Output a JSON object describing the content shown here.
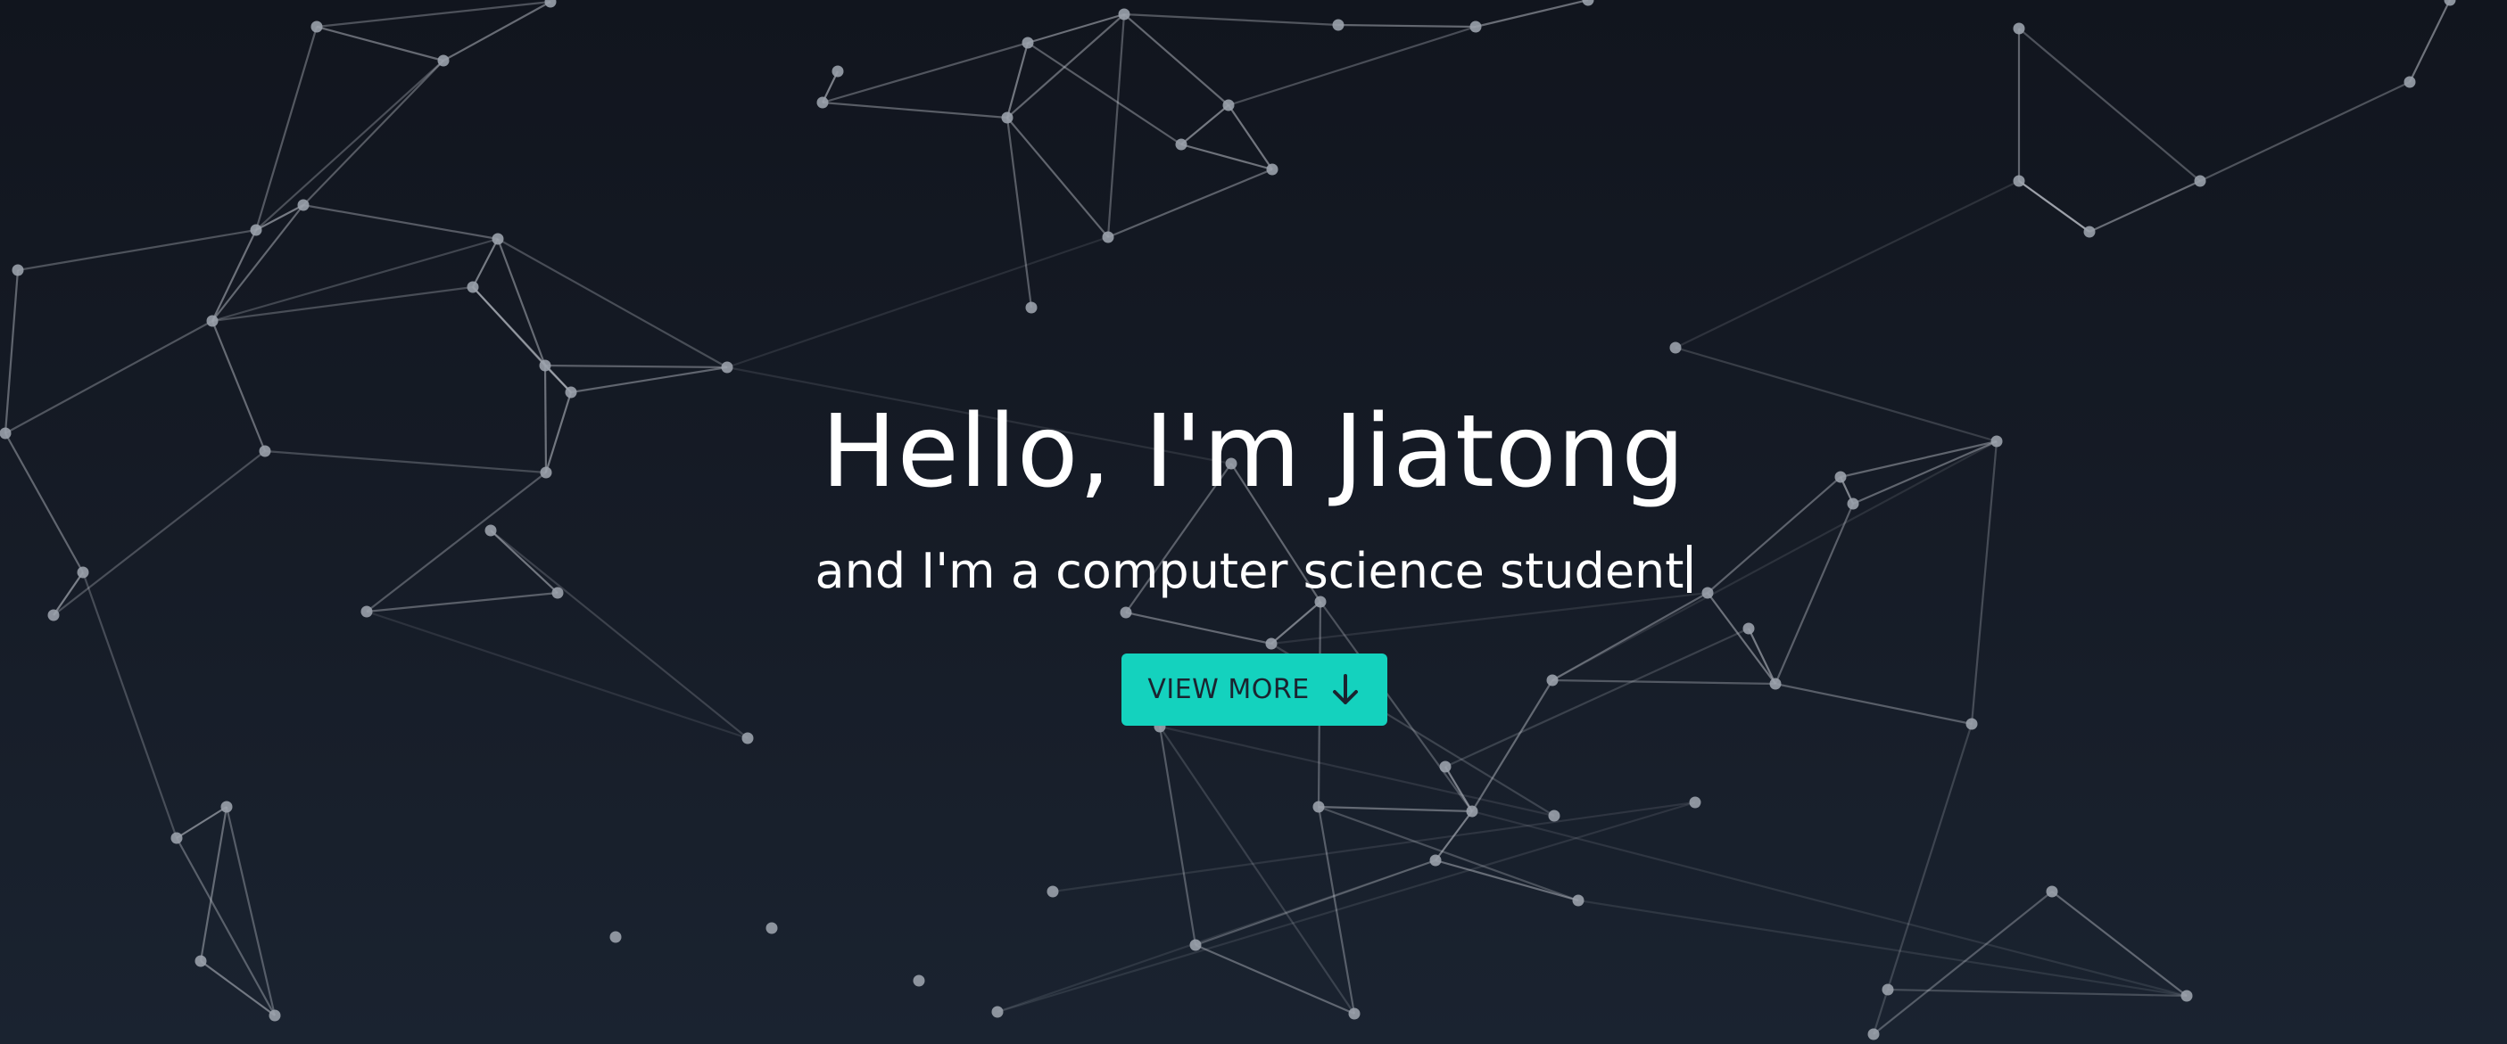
{
  "hero": {
    "title": "Hello, I'm Jiatong",
    "subtitle": "and I'm a computer science student",
    "cta_label": "VIEW MORE",
    "cta_icon": "arrow-down-icon"
  },
  "colors": {
    "background_top": "#11151e",
    "background_bottom": "#1a2330",
    "accent": "#14d2be",
    "text": "#ffffff",
    "network_lines": "#c8ccd4",
    "network_nodes": "#9aa1ab"
  }
}
